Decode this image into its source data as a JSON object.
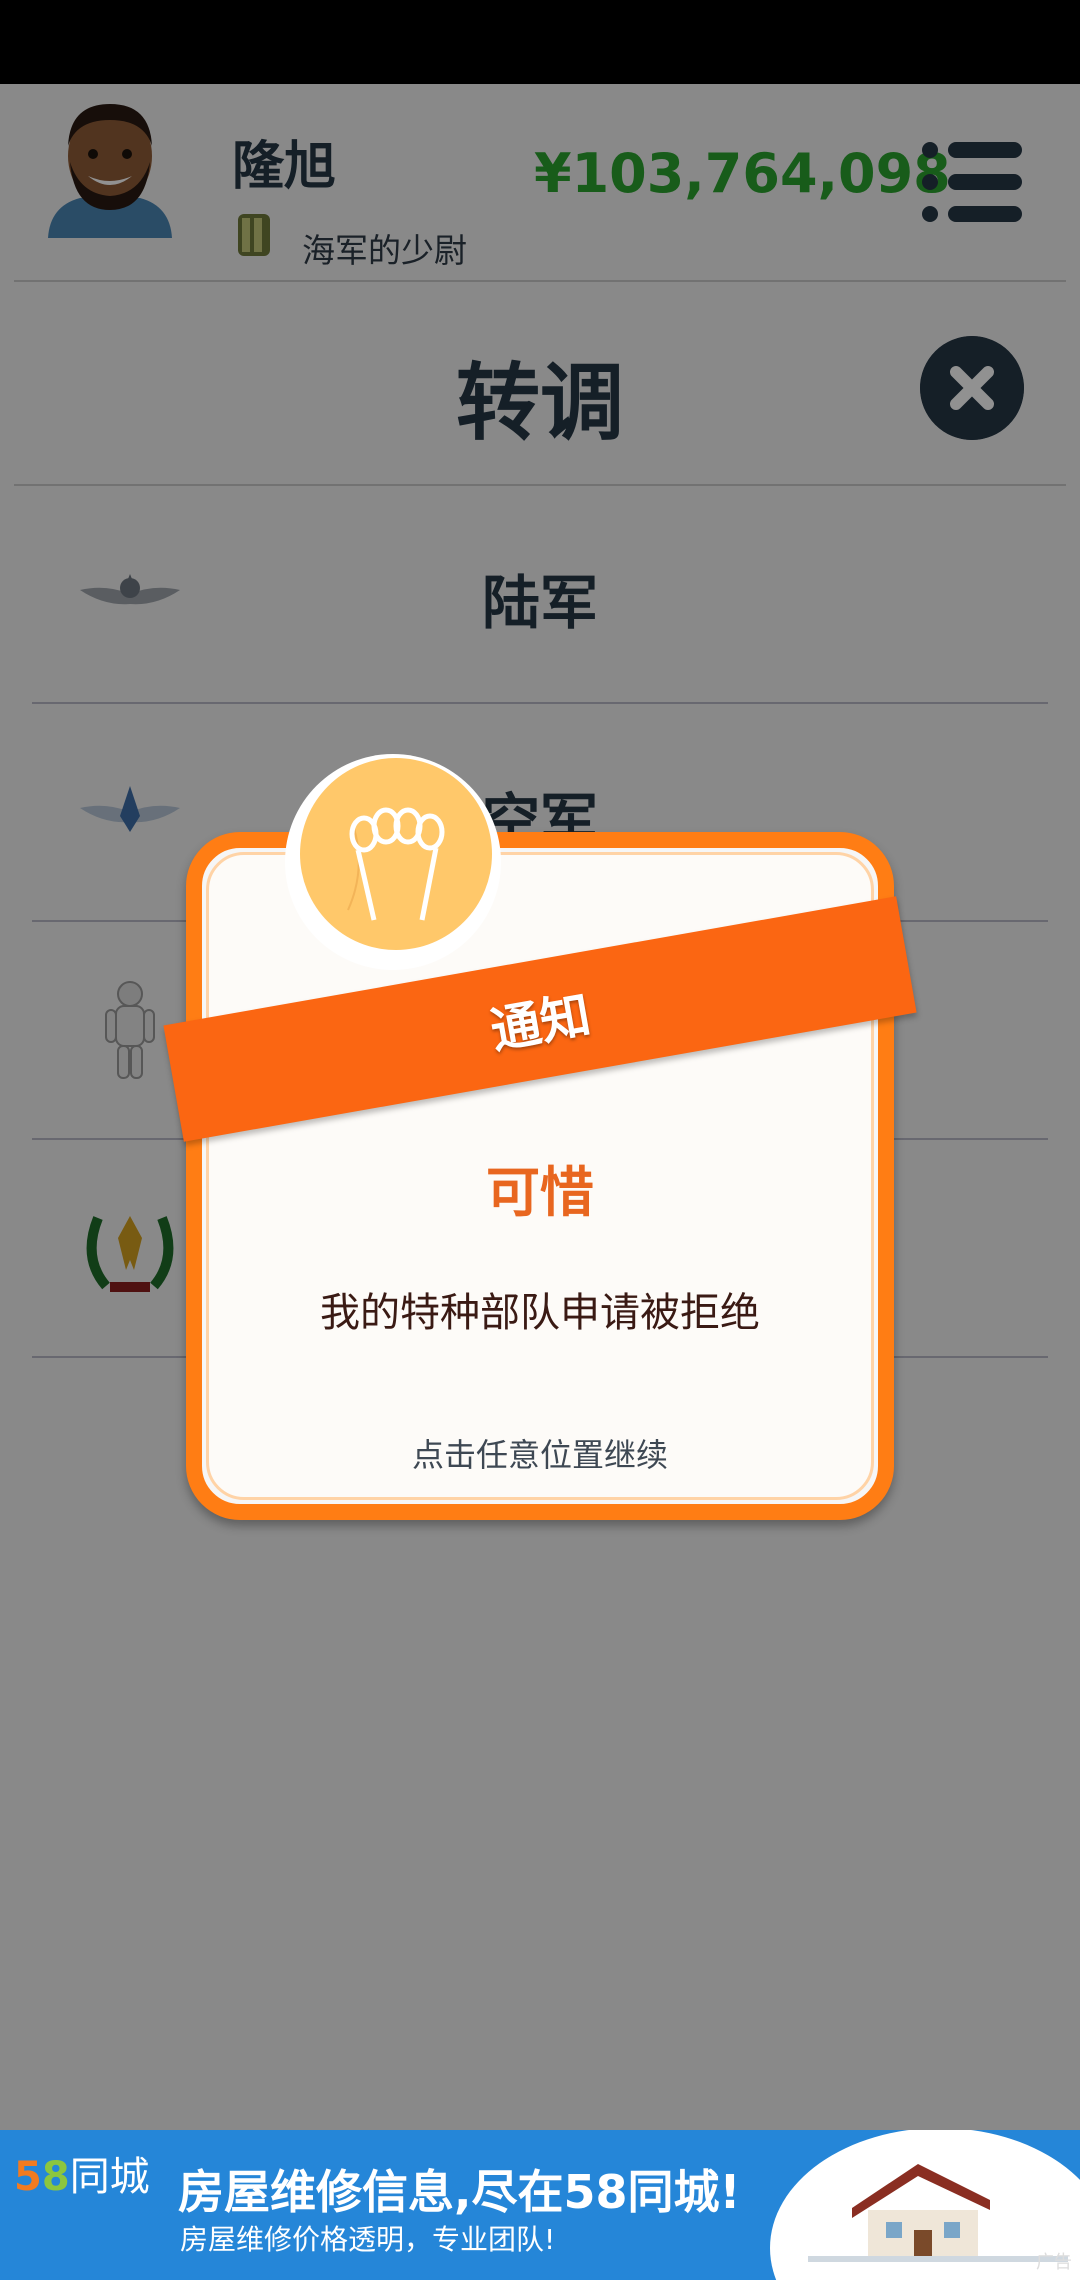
{
  "header": {
    "player_name": "隆旭",
    "rank": "海军的少尉",
    "money": "¥103,764,098",
    "menu_icon": "list-menu-icon"
  },
  "transfer": {
    "title": "转调",
    "close_icon": "close-icon",
    "branches": [
      {
        "label": "陆军",
        "icon": "army-wings-emblem"
      },
      {
        "label": "空军",
        "icon": "air-force-wings-emblem"
      },
      {
        "label": "",
        "icon": "astronaut-figure"
      },
      {
        "label": "",
        "icon": "special-forces-laurel-emblem"
      }
    ]
  },
  "dialog": {
    "ribbon": "通知",
    "title": "可惜",
    "message": "我的特种部队申请被拒绝",
    "hint": "点击任意位置继续",
    "icon": "lightbulb-icon"
  },
  "ad": {
    "logo_num_5": "5",
    "logo_num_8": "8",
    "logo_text": "同城",
    "title": "房屋维修信息,尽在58同城!",
    "subtitle": "房屋维修价格透明，专业团队!",
    "mark": "广告"
  },
  "colors": {
    "accent": "#ff7d14",
    "money": "#2ba32e",
    "text_dark": "#263746",
    "ad_blue": "#2586d8"
  }
}
